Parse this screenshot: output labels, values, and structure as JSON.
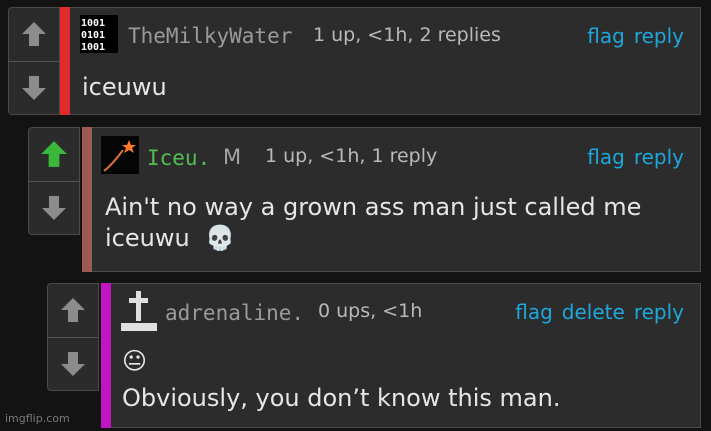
{
  "colors": {
    "accent_link": "#1ea7dc",
    "bar_comment1": "#e12a2a",
    "bar_comment2": "#9d5a55",
    "bar_comment3": "#c314c3",
    "upvoted_arrow": "#3bb73b",
    "iceu_name": "#4fc04f"
  },
  "comments": [
    {
      "username": "TheMilkyWater",
      "meta": "1 up, <1h, 2 replies",
      "actions": [
        "flag",
        "reply"
      ],
      "text_lines": [
        "iceuwu"
      ],
      "avatar_icon": "binary-pixel-icon",
      "upvoted": false
    },
    {
      "username": "Iceu.",
      "mod_badge": "M",
      "meta": "1 up, <1h, 1 reply",
      "actions": [
        "flag",
        "reply"
      ],
      "text_lines": [
        "Ain't no way a grown ass man just called me",
        "iceuwu"
      ],
      "emoji": "💀",
      "avatar_icon": "shooting-star-icon",
      "upvoted": true
    },
    {
      "username": "adrenaline.",
      "meta": "0 ups, <1h",
      "actions": [
        "flag",
        "delete",
        "reply"
      ],
      "emoji": "😐",
      "text_lines": [
        "Obviously, you don’t know this man."
      ],
      "avatar_icon": "grave-cross-icon",
      "upvoted": false
    }
  ],
  "watermark": "imgflip.com"
}
